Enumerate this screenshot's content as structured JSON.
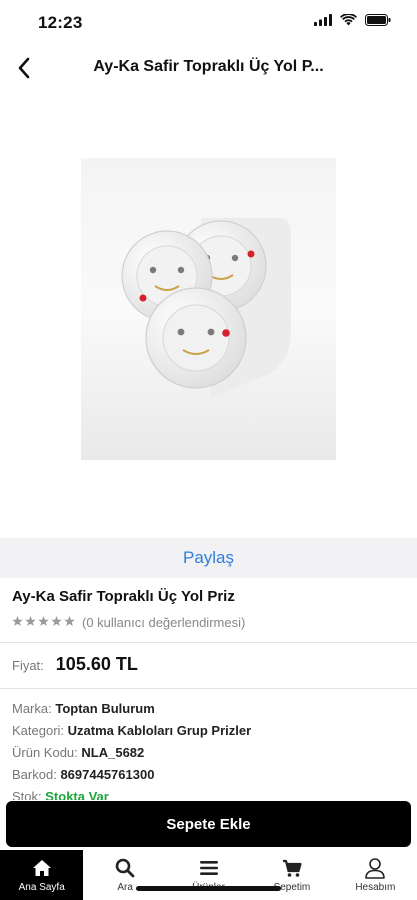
{
  "status_bar": {
    "time": "12:23",
    "icons": [
      "signal-icon",
      "wifi-icon",
      "battery-icon"
    ]
  },
  "navbar": {
    "back_icon": "chevron-left-icon",
    "title": "Ay-Ka Safir Topraklı Üç Yol P..."
  },
  "share": {
    "label": "Paylaş"
  },
  "product": {
    "name": "Ay-Ka Safir Topraklı Üç Yol Priz",
    "stars_filled": 0,
    "stars_total": 5,
    "rating_text": "(0 kullanıcı değerlendirmesi)",
    "price_label": "Fiyat:",
    "price": "105.60 TL",
    "details": [
      {
        "label": "Marka:",
        "value": "Toptan Bulurum"
      },
      {
        "label": "Kategori:",
        "value": "Uzatma Kabloları Grup Prizler"
      },
      {
        "label": "Ürün Kodu:",
        "value": "NLA_5682"
      },
      {
        "label": "Barkod:",
        "value": "8697445761300"
      },
      {
        "label": "Stok:",
        "value": "Stokta Var"
      }
    ]
  },
  "actions": {
    "add_to_cart": "Sepete Ekle"
  },
  "tabbar": {
    "items": [
      {
        "label": "Ana Sayfa",
        "icon": "home-icon",
        "active": true
      },
      {
        "label": "Ara",
        "icon": "search-icon",
        "active": false
      },
      {
        "label": "Ürünler",
        "icon": "menu-icon",
        "active": false
      },
      {
        "label": "Sepetim",
        "icon": "cart-icon",
        "active": false
      },
      {
        "label": "Hesabım",
        "icon": "user-icon",
        "active": false
      }
    ]
  },
  "colors": {
    "accent_link": "#2f7fe0",
    "in_stock": "#1fa33a",
    "primary_button": "#000000"
  }
}
